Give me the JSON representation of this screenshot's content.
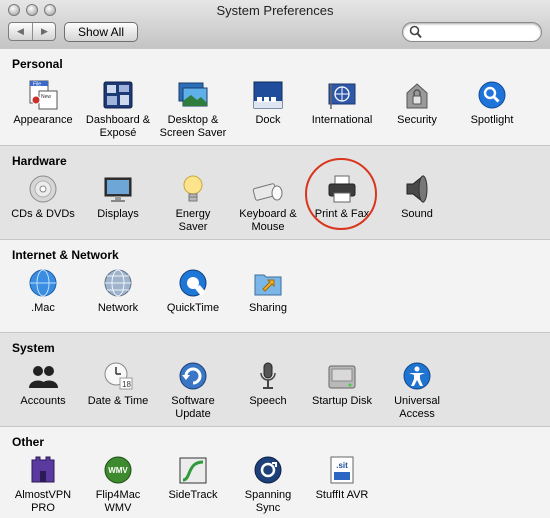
{
  "window": {
    "title": "System Preferences"
  },
  "toolbar": {
    "back_label": "◀",
    "forward_label": "▶",
    "show_all_label": "Show All"
  },
  "search": {
    "value": "",
    "placeholder": ""
  },
  "sections": [
    {
      "title": "Personal",
      "items": [
        {
          "label": "Appearance",
          "icon": "appearance-icon"
        },
        {
          "label": "Dashboard &\nExposé",
          "icon": "dashboard-expose-icon"
        },
        {
          "label": "Desktop &\nScreen Saver",
          "icon": "desktop-screensaver-icon"
        },
        {
          "label": "Dock",
          "icon": "dock-icon"
        },
        {
          "label": "International",
          "icon": "international-icon"
        },
        {
          "label": "Security",
          "icon": "security-icon"
        },
        {
          "label": "Spotlight",
          "icon": "spotlight-icon"
        }
      ]
    },
    {
      "title": "Hardware",
      "items": [
        {
          "label": "CDs & DVDs",
          "icon": "cd-dvd-icon"
        },
        {
          "label": "Displays",
          "icon": "displays-icon"
        },
        {
          "label": "Energy\nSaver",
          "icon": "energy-saver-icon"
        },
        {
          "label": "Keyboard &\nMouse",
          "icon": "keyboard-mouse-icon"
        },
        {
          "label": "Print & Fax",
          "icon": "printer-icon"
        },
        {
          "label": "Sound",
          "icon": "speaker-icon"
        }
      ]
    },
    {
      "title": "Internet & Network",
      "items": [
        {
          "label": ".Mac",
          "icon": "dotmac-icon"
        },
        {
          "label": "Network",
          "icon": "network-icon"
        },
        {
          "label": "QuickTime",
          "icon": "quicktime-icon"
        },
        {
          "label": "Sharing",
          "icon": "sharing-icon"
        }
      ]
    },
    {
      "title": "System",
      "items": [
        {
          "label": "Accounts",
          "icon": "accounts-icon"
        },
        {
          "label": "Date & Time",
          "icon": "date-time-icon"
        },
        {
          "label": "Software\nUpdate",
          "icon": "software-update-icon"
        },
        {
          "label": "Speech",
          "icon": "microphone-icon"
        },
        {
          "label": "Startup Disk",
          "icon": "startup-disk-icon"
        },
        {
          "label": "Universal\nAccess",
          "icon": "universal-access-icon"
        }
      ]
    },
    {
      "title": "Other",
      "items": [
        {
          "label": "AlmostVPN\nPRO",
          "icon": "almostvpn-icon"
        },
        {
          "label": "Flip4Mac\nWMV",
          "icon": "flip4mac-icon"
        },
        {
          "label": "SideTrack",
          "icon": "sidetrack-icon"
        },
        {
          "label": "Spanning\nSync",
          "icon": "spanning-sync-icon"
        },
        {
          "label": "StuffIt AVR",
          "icon": "stuffit-icon"
        }
      ]
    }
  ],
  "icon_text": {
    "appearance_a": "File",
    "appearance_b": "New",
    "energy_bulb": "",
    "date_day": "18",
    "stuffit": ".sit",
    "flip4mac": "WMV"
  },
  "colors": {
    "highlight_circle": "#d9361e",
    "spotlight": "#1e74d8",
    "international": "#2f57a8"
  }
}
